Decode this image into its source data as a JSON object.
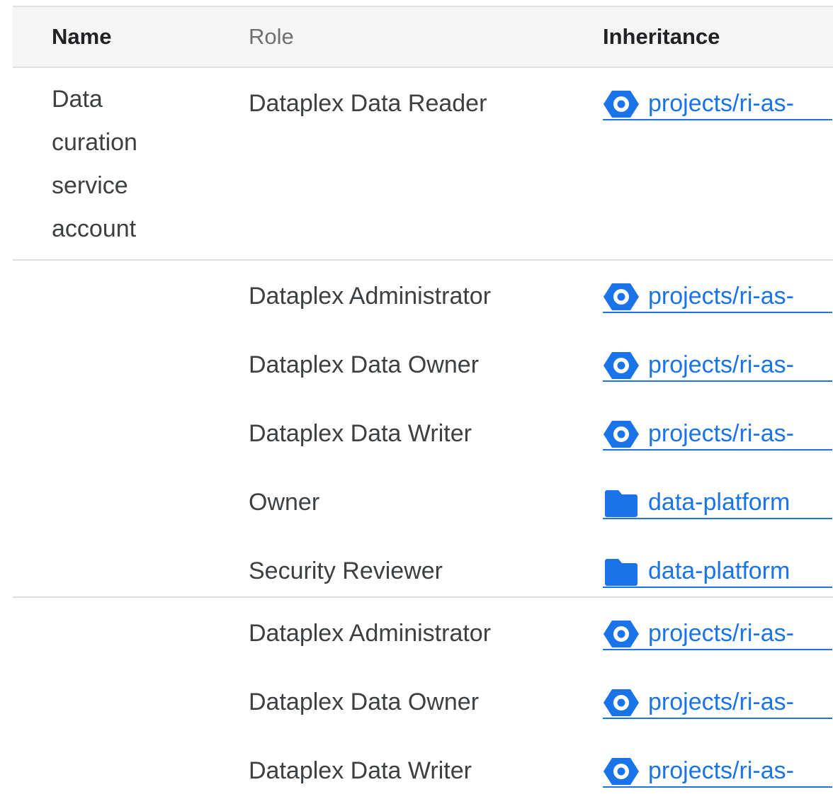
{
  "headers": {
    "name": "Name",
    "role": "Role",
    "inheritance": "Inheritance"
  },
  "colors": {
    "link": "#1a73e8",
    "text": "#3c4043",
    "header_muted": "#6f6f6f",
    "divider": "#e0e0e0"
  },
  "groups": [
    {
      "name": "Data curation service account",
      "rows": [
        {
          "role": "Dataplex Data Reader",
          "inheritance": "projects/ri-as-",
          "icon": "project-hexagon-icon"
        }
      ]
    },
    {
      "name": "",
      "rows": [
        {
          "role": "Dataplex Administrator",
          "inheritance": "projects/ri-as-",
          "icon": "project-hexagon-icon"
        },
        {
          "role": "Dataplex Data Owner",
          "inheritance": "projects/ri-as-",
          "icon": "project-hexagon-icon"
        },
        {
          "role": "Dataplex Data Writer",
          "inheritance": "projects/ri-as-",
          "icon": "project-hexagon-icon"
        },
        {
          "role": "Owner",
          "inheritance": "data-platform",
          "icon": "folder-icon"
        },
        {
          "role": "Security Reviewer",
          "inheritance": "data-platform",
          "icon": "folder-icon"
        }
      ]
    },
    {
      "name": "",
      "rows": [
        {
          "role": "Dataplex Administrator",
          "inheritance": "projects/ri-as-",
          "icon": "project-hexagon-icon"
        },
        {
          "role": "Dataplex Data Owner",
          "inheritance": "projects/ri-as-",
          "icon": "project-hexagon-icon"
        },
        {
          "role": "Dataplex Data Writer",
          "inheritance": "projects/ri-as-",
          "icon": "project-hexagon-icon"
        }
      ]
    }
  ]
}
